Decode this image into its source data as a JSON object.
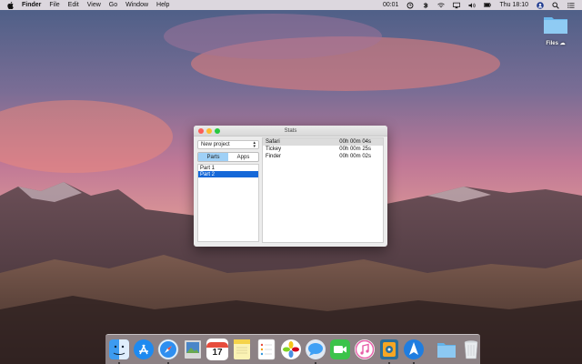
{
  "menubar": {
    "app_name": "Finder",
    "menus": [
      "File",
      "Edit",
      "View",
      "Go",
      "Window",
      "Help"
    ],
    "timer": "00:01",
    "battery": "100%",
    "clock": "Thu 18:10"
  },
  "desktop": {
    "folder_label": "Files"
  },
  "window": {
    "title": "Stats",
    "project_select": "New project",
    "tabs": [
      {
        "label": "Parts",
        "active": true
      },
      {
        "label": "Apps",
        "active": false
      }
    ],
    "parts": [
      {
        "label": "Part 1",
        "selected": false
      },
      {
        "label": "Part 2",
        "selected": true
      }
    ],
    "apps": [
      {
        "name": "Safari",
        "time": "00h 00m 04s"
      },
      {
        "name": "Tickey",
        "time": "00h 00m 25s"
      },
      {
        "name": "Finder",
        "time": "00h 00m 02s"
      }
    ]
  },
  "dock": {
    "calendar_day": "17",
    "apps": [
      "finder-icon",
      "app-store-icon",
      "safari-icon",
      "preview-icon",
      "calendar-icon",
      "notes-icon",
      "reminders-icon",
      "photos-icon",
      "messages-icon",
      "facetime-icon",
      "itunes-icon",
      "tickey-icon",
      "testflight-icon",
      "folder-icon",
      "trash-icon"
    ]
  },
  "colors": {
    "selection": "#1568d8",
    "active_tab": "#9fd0f6",
    "close": "#fc5f57",
    "minimize": "#fdbc2e",
    "maximize": "#28c840"
  }
}
